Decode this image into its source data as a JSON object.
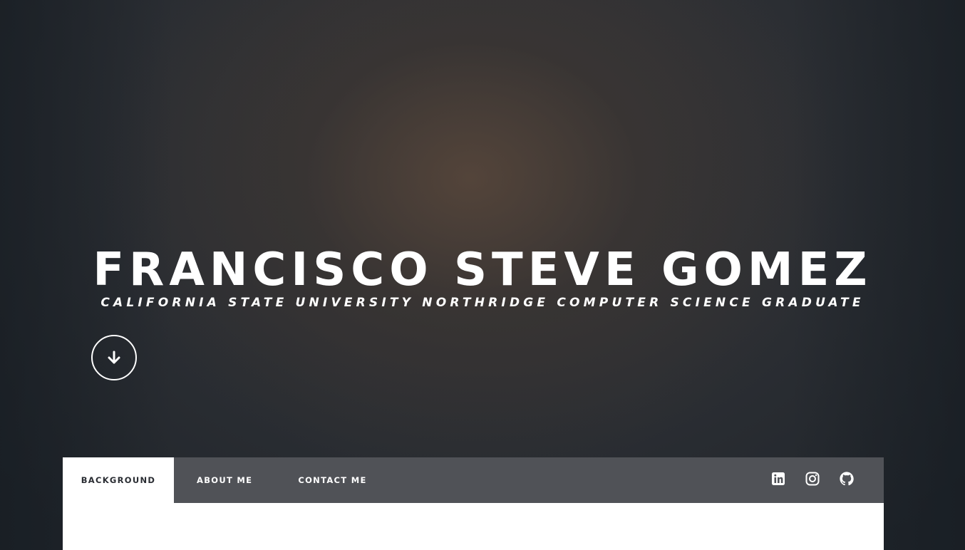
{
  "hero": {
    "name": "FRANCISCO STEVE GOMEZ",
    "tagline": "CALIFORNIA STATE UNIVERSITY NORTHRIDGE COMPUTER SCIENCE GRADUATE",
    "scroll_icon": "arrow-down-icon"
  },
  "nav": {
    "tabs": [
      {
        "label": "BACKGROUND",
        "active": true
      },
      {
        "label": "ABOUT ME",
        "active": false
      },
      {
        "label": "CONTACT ME",
        "active": false
      }
    ],
    "social": [
      {
        "icon": "linkedin-icon"
      },
      {
        "icon": "instagram-icon"
      },
      {
        "icon": "github-icon"
      }
    ]
  },
  "colors": {
    "nav_background": "#505257",
    "active_tab_background": "#ffffff",
    "active_tab_text": "#2a2d33",
    "hero_text": "#ffffff"
  }
}
